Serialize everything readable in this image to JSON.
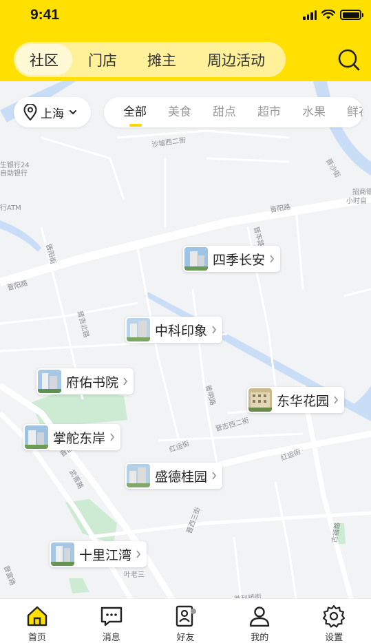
{
  "status_bar": {
    "time": "9:41"
  },
  "header": {
    "segments": [
      {
        "label": "社区",
        "active": true
      },
      {
        "label": "门店",
        "active": false
      },
      {
        "label": "摊主",
        "active": false
      },
      {
        "label": "周边活动",
        "active": false
      }
    ],
    "search_icon": "search-icon"
  },
  "filters": {
    "city": "上海",
    "categories": [
      "全部",
      "美食",
      "甜点",
      "超市",
      "水果",
      "鲜花"
    ],
    "active_category": "全部",
    "accent_color": "#FFD400"
  },
  "map": {
    "labels": {
      "bank1": "生银行24",
      "bank1b": "自助银行",
      "atm": "行ATM",
      "shahua": "沙墟西二街",
      "jinyang1": "晋阳路",
      "jinyang2": "晋阳路",
      "zhaoshang": "招商银",
      "zhaoshangb": "小时自",
      "jishi": "晋沙街",
      "jiyang3": "晋阳街",
      "jiji": "晋吉北路",
      "jifeng": "晋丰路",
      "jinzhi": "晋志西二街",
      "hongjun": "红运街",
      "hongjun2": "红运街",
      "shengming": "普明路",
      "jixi": "晋西三街",
      "yelao": "叶老三",
      "shengli": "胜利桥街",
      "guhua": "古福路",
      "wushi": "武晋路",
      "jinxi": "晋昌西",
      "jinding": "普富路"
    }
  },
  "markers": [
    {
      "name": "四季长安"
    },
    {
      "name": "中科印象"
    },
    {
      "name": "府佑书院"
    },
    {
      "name": "东华花园"
    },
    {
      "name": "掌舵东岸"
    },
    {
      "name": "盛德桂园"
    },
    {
      "name": "十里江湾"
    }
  ],
  "tabbar": {
    "items": [
      {
        "label": "首页",
        "icon": "home-icon",
        "active": true
      },
      {
        "label": "消息",
        "icon": "message-icon",
        "active": false
      },
      {
        "label": "好友",
        "icon": "contacts-icon",
        "active": false
      },
      {
        "label": "我的",
        "icon": "user-icon",
        "active": false
      },
      {
        "label": "设置",
        "icon": "gear-icon",
        "active": false
      }
    ]
  },
  "colors": {
    "brand": "#FFE000",
    "segment_bg": "#FFF09A",
    "water": "#C9DDF7",
    "park": "#CDEBD2"
  }
}
